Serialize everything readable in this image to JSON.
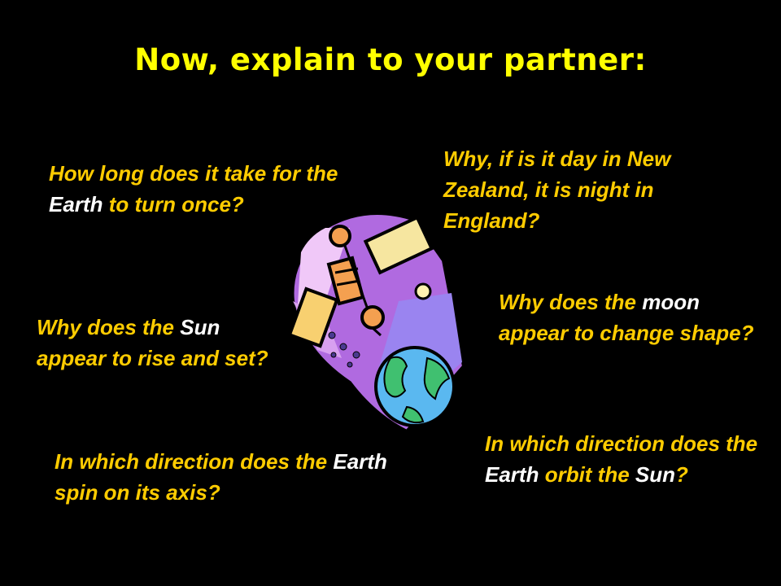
{
  "title": "Now, explain to your partner:",
  "questions": [
    {
      "id": "q1",
      "parts": [
        {
          "t": "How long does it take for the "
        },
        {
          "t": "Earth",
          "hl": true
        },
        {
          "t": " to turn once?"
        }
      ]
    },
    {
      "id": "q2",
      "parts": [
        {
          "t": "Why, if is it day in New Zealand, it is night in England?"
        }
      ]
    },
    {
      "id": "q3",
      "parts": [
        {
          "t": "Why does the "
        },
        {
          "t": "moon",
          "hl": true
        },
        {
          "t": " appear to change shape?"
        }
      ]
    },
    {
      "id": "q4",
      "parts": [
        {
          "t": "Why does the "
        },
        {
          "t": "Sun",
          "hl": true
        },
        {
          "t": " appear to rise and set?"
        }
      ]
    },
    {
      "id": "q5",
      "parts": [
        {
          "t": "In which direction does the "
        },
        {
          "t": "Earth",
          "hl": true
        },
        {
          "t": " spin on its axis?"
        }
      ]
    },
    {
      "id": "q6",
      "parts": [
        {
          "t": "In which direction does the "
        },
        {
          "t": "Earth",
          "hl": true
        },
        {
          "t": " orbit the "
        },
        {
          "t": "Sun",
          "hl": true
        },
        {
          "t": "?"
        }
      ]
    }
  ],
  "colors": {
    "background": "#000000",
    "title": "#ffff00",
    "question": "#ffcc00",
    "highlight": "#ffffff"
  },
  "clipart": "space-satellite-earth-clipart"
}
